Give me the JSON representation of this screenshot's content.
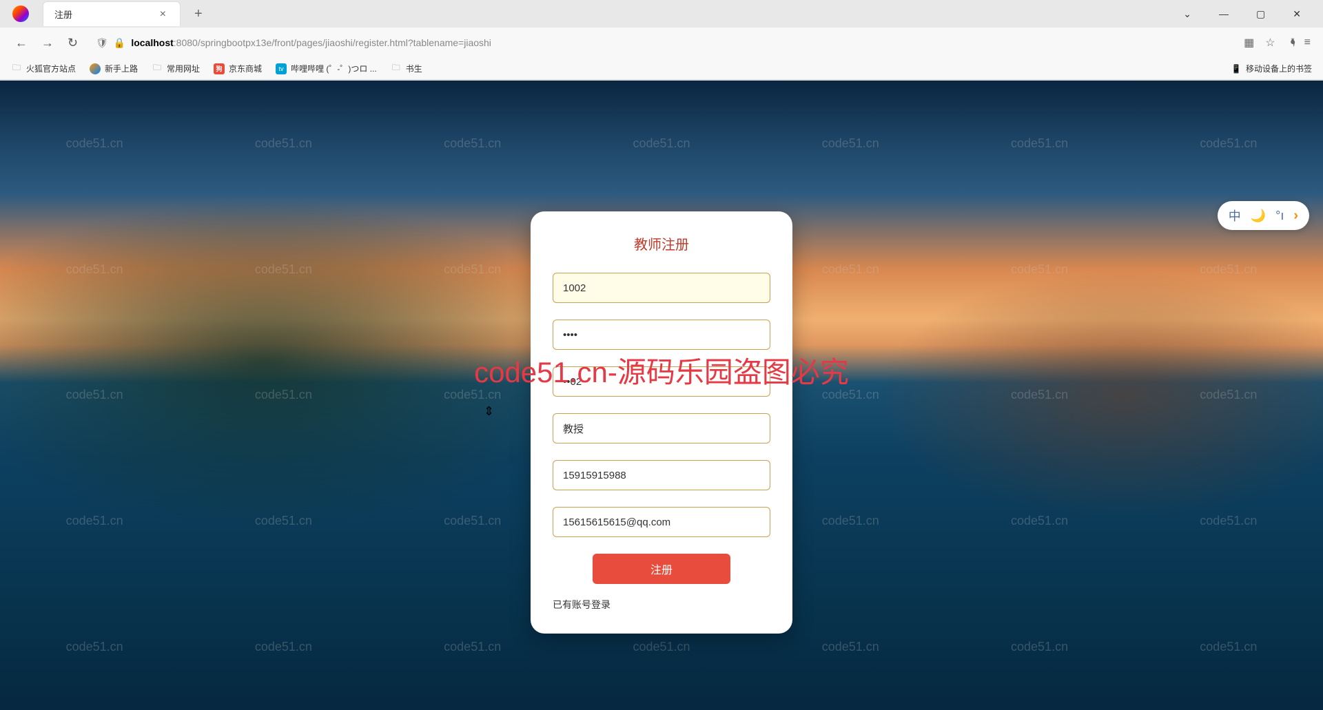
{
  "browser": {
    "tab_title": "注册",
    "url_host": "localhost",
    "url_port_path": ":8080/springbootpx13e/front/pages/jiaoshi/register.html?tablename=jiaoshi"
  },
  "bookmarks": {
    "items": [
      {
        "label": "火狐官方站点"
      },
      {
        "label": "新手上路"
      },
      {
        "label": "常用网址"
      },
      {
        "label": "京东商城"
      },
      {
        "label": "哔哩哔哩 (゜-゜)つロ ..."
      },
      {
        "label": "书生"
      }
    ],
    "mobile": "移动设备上的书签"
  },
  "ime": {
    "lang": "中"
  },
  "watermark": {
    "small": "code51.cn",
    "big": "code51.cn-源码乐园盗图必究"
  },
  "form": {
    "title": "教师注册",
    "fields": {
      "username": {
        "value": "1002"
      },
      "password": {
        "value": "••••"
      },
      "confirm": {
        "value": "••02"
      },
      "title_field": {
        "value": "教授"
      },
      "phone": {
        "value": "15915915988"
      },
      "email": {
        "value": "15615615615@qq.com"
      }
    },
    "submit": "注册",
    "login_link": "已有账号登录"
  }
}
